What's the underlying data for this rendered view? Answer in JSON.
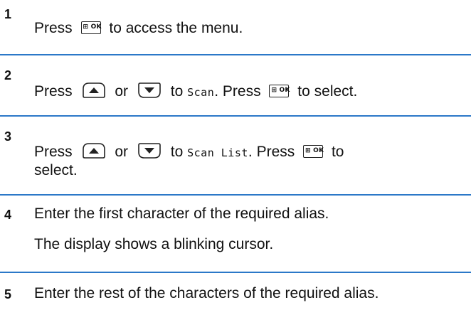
{
  "steps": [
    {
      "number": "1",
      "parts": {
        "a": "Press",
        "b": "to access the menu."
      }
    },
    {
      "number": "2",
      "parts": {
        "a": "Press",
        "or": "or",
        "to": "to",
        "menu_item": "Scan",
        "period": ".",
        "press2": "Press",
        "end": "to select."
      }
    },
    {
      "number": "3",
      "parts": {
        "a": "Press",
        "or": "or",
        "to": "to",
        "menu_item": "Scan List",
        "period": ".",
        "press2": "Press",
        "end": "to",
        "line2": "select."
      }
    },
    {
      "number": "4",
      "parts": {
        "a": "Enter the first character of the required alias.",
        "b": "The display shows a blinking cursor."
      }
    },
    {
      "number": "5",
      "parts": {
        "a": "Enter the rest of the characters of the required alias."
      }
    }
  ],
  "keys": {
    "ok_key_label": "⊞ OK",
    "up_key_icon": "up-arrow-key-icon",
    "down_key_icon": "down-arrow-key-icon"
  },
  "colors": {
    "divider": "#2b78c8"
  }
}
